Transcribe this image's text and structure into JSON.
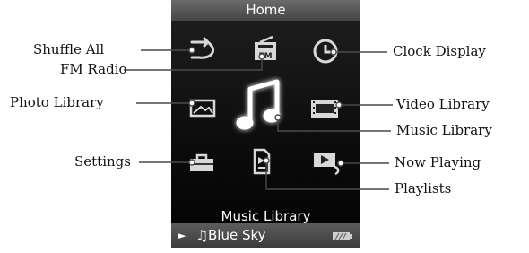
{
  "device": {
    "title": "Home",
    "selected_item_label": "Music Library",
    "now_playing": {
      "title": "Blue Sky",
      "arrow": "►",
      "note": "♫"
    }
  },
  "menu_icons": [
    {
      "name": "shuffle-all-icon",
      "selected": false
    },
    {
      "name": "fm-radio-icon",
      "selected": false,
      "text": "FM"
    },
    {
      "name": "clock-display-icon",
      "selected": false
    },
    {
      "name": "photo-library-icon",
      "selected": false
    },
    {
      "name": "music-library-icon",
      "selected": true
    },
    {
      "name": "video-library-icon",
      "selected": false
    },
    {
      "name": "settings-icon",
      "selected": false
    },
    {
      "name": "playlists-icon",
      "selected": false
    },
    {
      "name": "now-playing-icon",
      "selected": false
    }
  ],
  "callouts": {
    "shuffle_all": "Shuffle All",
    "fm_radio": "FM Radio",
    "photo_library": "Photo Library",
    "settings": "Settings",
    "clock_display": "Clock Display",
    "video_library": "Video Library",
    "music_library": "Music Library",
    "now_playing": "Now Playing",
    "playlists": "Playlists"
  },
  "colors": {
    "screen": "#000000",
    "bar": "#555555",
    "icon": "#d8d8d8",
    "text": "#ffffff",
    "callout_text": "#111111"
  }
}
